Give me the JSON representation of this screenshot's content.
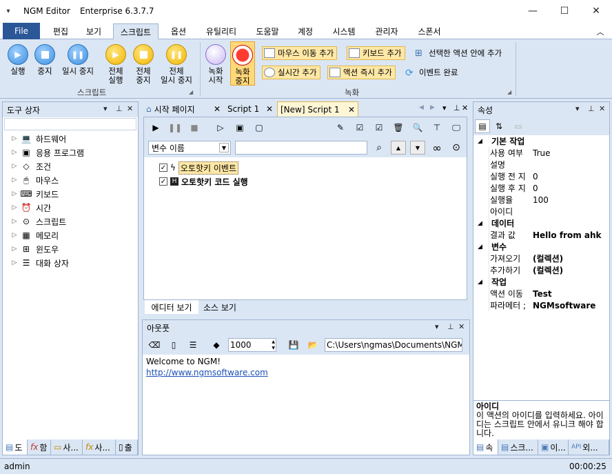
{
  "window": {
    "app_name": "NGM Editor",
    "edition": "Enterprise 6.3.7.7"
  },
  "menu": {
    "file": "File",
    "tabs": [
      "편집",
      "보기",
      "스크립트",
      "옵션",
      "유틸리티",
      "도움말",
      "계정",
      "시스템",
      "관리자",
      "스폰서"
    ],
    "active": "스크립트"
  },
  "ribbon": {
    "script_group": {
      "label": "스크립트",
      "run": "실행",
      "stop": "중지",
      "pause": "일시 중지",
      "run_all_1": "전체",
      "run_all_2": "실행",
      "stop_all_1": "전체",
      "stop_all_2": "중지",
      "pause_all_1": "전체",
      "pause_all_2": "일시 중지"
    },
    "record_group": {
      "label": "녹화",
      "record_start_1": "녹화",
      "record_start_2": "시작",
      "record_stop_1": "녹화",
      "record_stop_2": "중지",
      "add_mouse_move": "마우스 이동 추가",
      "add_keyboard": "키보드 추가",
      "add_in_selected": "선택한 액션 안에 추가",
      "add_realtime": "실시간 추가",
      "add_action_now": "액션 즉시 추가",
      "event_complete": "이벤트 완료"
    }
  },
  "toolbox": {
    "title": "도구 상자",
    "items": [
      "하드웨어",
      "응용 프로그램",
      "조건",
      "마우스",
      "키보드",
      "시간",
      "스크립트",
      "메모리",
      "윈도우",
      "대화 상자"
    ],
    "bottom_tabs": [
      "도",
      "함",
      "사...",
      "사...",
      "출"
    ]
  },
  "editor": {
    "tabs": [
      "시작 페이지",
      "Script 1",
      "[New] Script 1"
    ],
    "variable_select": "변수 이름",
    "actions": [
      {
        "label": "오토핫키 이벤트",
        "checked": true
      },
      {
        "label": "오토핫키 코드 실행",
        "checked": true
      }
    ],
    "view_tabs": [
      "에디터 보기",
      "소스 보기"
    ]
  },
  "output": {
    "title": "아웃풋",
    "count": "1000",
    "path": "C:\\Users\\ngmas\\Documents\\NGM6\\",
    "lines": [
      "Welcome to NGM!",
      "http://www.ngmsoftware.com"
    ]
  },
  "properties": {
    "title": "속성",
    "categories": [
      {
        "name": "기본 작업",
        "rows": [
          {
            "k": "사용 여부",
            "v": "True"
          },
          {
            "k": "설명",
            "v": ""
          },
          {
            "k": "실행 전 지",
            "v": "0"
          },
          {
            "k": "실행 후 지",
            "v": "0"
          },
          {
            "k": "실행율",
            "v": "100"
          },
          {
            "k": "아이디",
            "v": ""
          }
        ]
      },
      {
        "name": "데이터",
        "rows": [
          {
            "k": "결과 값",
            "v": "Hello from ahk"
          }
        ]
      },
      {
        "name": "변수",
        "rows": [
          {
            "k": "가져오기",
            "v": "(컬렉션)"
          },
          {
            "k": "추가하기",
            "v": "(컬렉션)"
          }
        ]
      },
      {
        "name": "작업",
        "rows": [
          {
            "k": "액션 이동",
            "v": "Test"
          },
          {
            "k": "파라메터 ;",
            "v": "NGMsoftware"
          }
        ]
      }
    ],
    "help_title": "아이디",
    "help_text": "이 액션의 아이디를 입력하세요. 아이디는 스크립트 안에서 유니크 해야 합니다.",
    "bottom_tabs": [
      "속",
      "스크...",
      "이...",
      "외..."
    ]
  },
  "status": {
    "user": "admin",
    "time": "00:00:25"
  }
}
